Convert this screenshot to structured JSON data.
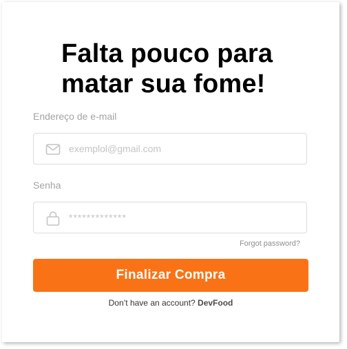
{
  "heading": {
    "line1": "Falta pouco para",
    "line2": "matar sua fome!"
  },
  "email": {
    "label": "Endereço de e-mail",
    "placeholder": "exemplol@gmail.com",
    "icon": "mail-icon"
  },
  "password": {
    "label": "Senha",
    "placeholder": "*************",
    "icon": "lock-icon"
  },
  "forgot_password": "Forgot password?",
  "submit_label": "Finalizar Compra",
  "signup": {
    "prompt": "Don’t have an account?",
    "link": "DevFood"
  },
  "colors": {
    "accent": "#f97316",
    "text": "#000000",
    "muted": "#a3a3a3",
    "border": "#dcdcdc"
  }
}
